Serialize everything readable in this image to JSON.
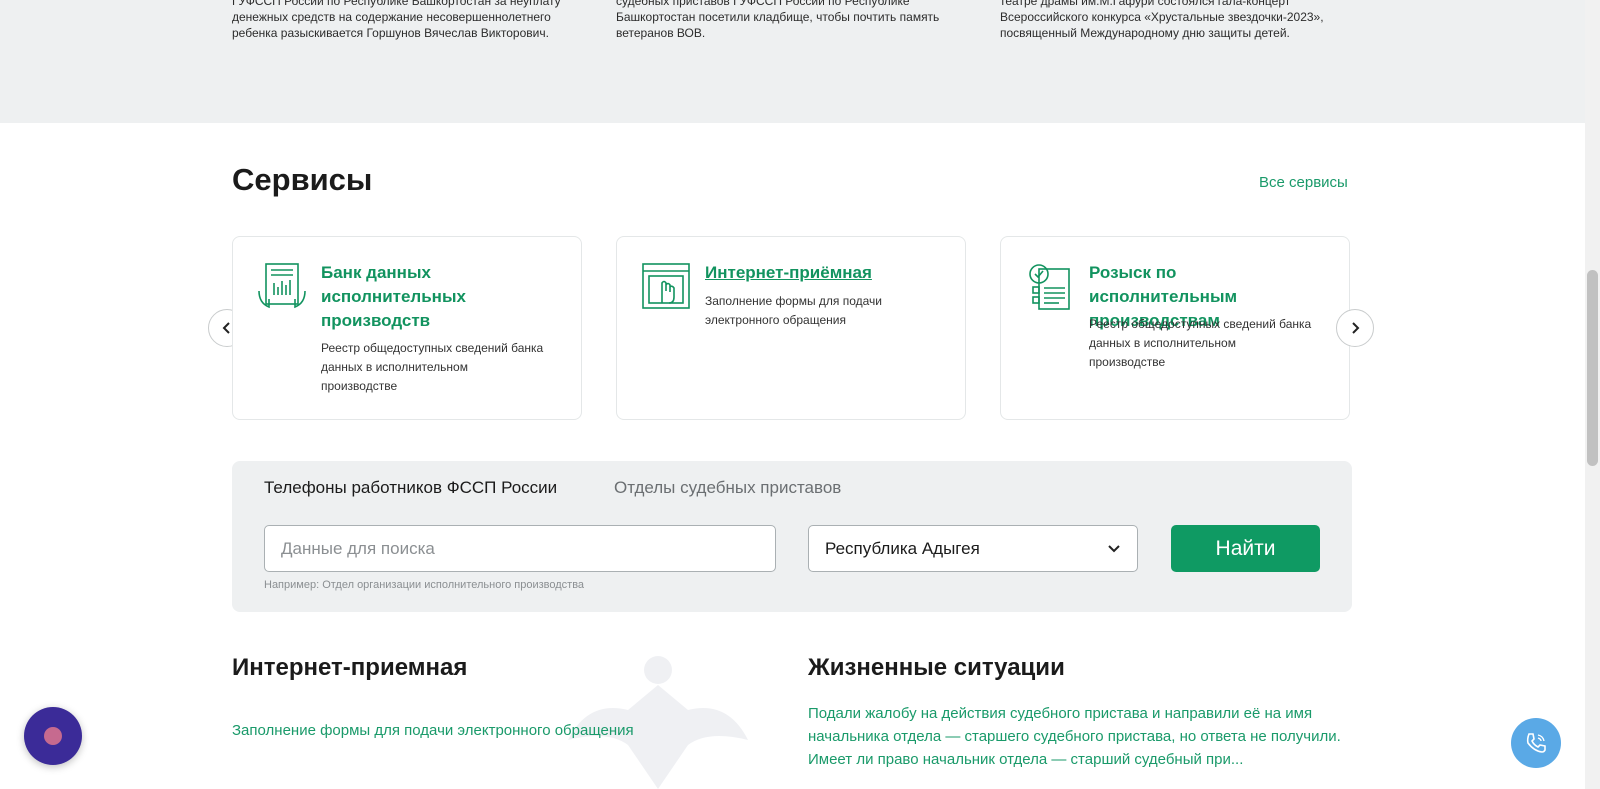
{
  "news": {
    "col1": "ГУФССП России по Республике Башкортостан за неуплату денежных средств на содержание несовершеннолетнего ребенка разыскивается Горшунов Вячеслав Викторович.",
    "col2": "судебных приставов ГУФССП России по Республике Башкортостан посетили кладбище, чтобы почтить память ветеранов ВОВ.",
    "col3": "театре драмы им.М.Гафури состоялся гала-концерт Всероссийского конкурса «Хрустальные звездочки-2023», посвященный Международному дню защиты детей."
  },
  "services": {
    "title": "Сервисы",
    "all_link": "Все сервисы",
    "cards": [
      {
        "title": "Банк данных исполнительных производств",
        "desc": "Реестр общедоступных сведений банка данных в исполнительном производстве",
        "icon": "bank-data-icon"
      },
      {
        "title": "Интернет-приёмная",
        "desc": "Заполнение формы для подачи электронного обращения",
        "icon": "reception-icon"
      },
      {
        "title": "Розыск по исполнительным производствам",
        "desc": "Реестр общедоступных сведений банка данных в исполнительном производстве",
        "icon": "search-docs-icon"
      }
    ]
  },
  "search": {
    "tab_active": "Телефоны работников ФССП России",
    "tab_inactive": "Отделы судебных приставов",
    "placeholder": "Данные для поиска",
    "region": "Республика Адыгея",
    "button": "Найти",
    "hint": "Например: Отдел организации исполнительного производства"
  },
  "reception": {
    "title": "Интернет-приемная",
    "link": "Заполнение формы для подачи электронного обращения"
  },
  "life": {
    "title": "Жизненные ситуации",
    "text": "Подали жалобу на действия судебного пристава и направили её на имя начальника отдела — старшего судебного пристава, но ответа не получили. Имеет ли право начальник отдела — старший судебный при..."
  },
  "colors": {
    "accent": "#0f9a63",
    "link": "#1a9a6a",
    "panel": "#eef0f1"
  }
}
